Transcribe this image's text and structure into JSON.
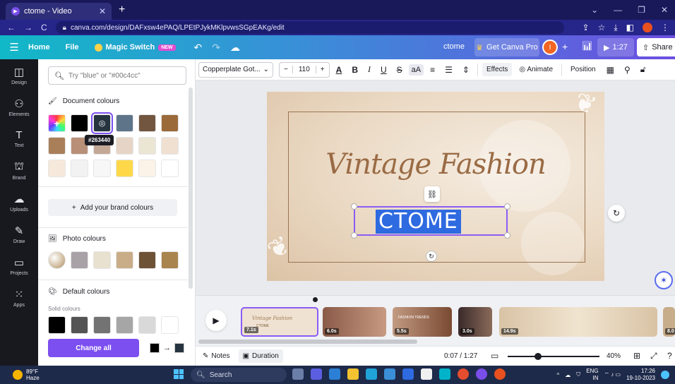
{
  "browser": {
    "tab_title": "ctome - Video",
    "url": "canva.com/design/DAFxsw4ePAQ/LPEtPJykMKlpvwsSGpEAKg/edit"
  },
  "header": {
    "home": "Home",
    "file": "File",
    "magic_switch": "Magic Switch",
    "new_badge": "NEW",
    "title": "ctome",
    "get_pro": "Get Canva Pro",
    "avatar_initial": "I",
    "play_time": "1:27",
    "share": "Share"
  },
  "rail": {
    "design": "Design",
    "elements": "Elements",
    "text": "Text",
    "brand": "Brand",
    "uploads": "Uploads",
    "draw": "Draw",
    "projects": "Projects",
    "apps": "Apps"
  },
  "panel": {
    "search_placeholder": "Try \"blue\" or \"#00c4cc\"",
    "document_colours": "Document colours",
    "tooltip": "#263440",
    "add_brand": "Add your brand colours",
    "photo_colours": "Photo colours",
    "default_colours": "Default colours",
    "solid_colours": "Solid colours",
    "change_all": "Change all",
    "doc_swatches": [
      "#7b3fe0",
      "#000000",
      "#263440",
      "#5e7589",
      "#725640",
      "#9b6a3b",
      "#a97f5a",
      "#b89078",
      "#c4a896",
      "#e6d5c6",
      "#ebe5d4",
      "#efe0d2",
      "#f6e9db",
      "#f2f2f2",
      "#f7f7f7",
      "#ffd84a",
      "#fcf3e8",
      "#ffffff"
    ],
    "photo_swatches": [
      "#e8ddd0",
      "#a8a2a6",
      "#e9e1cf",
      "#c9ad88",
      "#6e5236",
      "#a9844f"
    ],
    "default_swatches": [
      "#000000",
      "#545454",
      "#737373",
      "#a6a6a6",
      "#d9d9d9",
      "#ffffff"
    ]
  },
  "toolbar": {
    "font": "Copperplate Got...",
    "size": "110",
    "effects": "Effects",
    "animate": "Animate",
    "position": "Position"
  },
  "canvas": {
    "headline": "Vintage Fashion",
    "selected_text": "CTOME"
  },
  "timeline": {
    "clips": [
      {
        "duration": "7.1s"
      },
      {
        "duration": "6.0s"
      },
      {
        "duration": "5.5s"
      },
      {
        "duration": "3.0s"
      },
      {
        "duration": "14.9s"
      },
      {
        "duration": "8.0"
      }
    ],
    "clip1_title": "Vintage Fashion",
    "clip1_sub": "CTOME",
    "clip3_title": "FASHION TRENDS"
  },
  "footer": {
    "notes": "Notes",
    "duration": "Duration",
    "time": "0:07 / 1:27",
    "zoom": "40%"
  },
  "taskbar": {
    "temp": "89°F",
    "weather": "Haze",
    "search": "Search",
    "lang": "ENG",
    "region": "IN",
    "time": "17:26",
    "date": "19-10-2023"
  }
}
